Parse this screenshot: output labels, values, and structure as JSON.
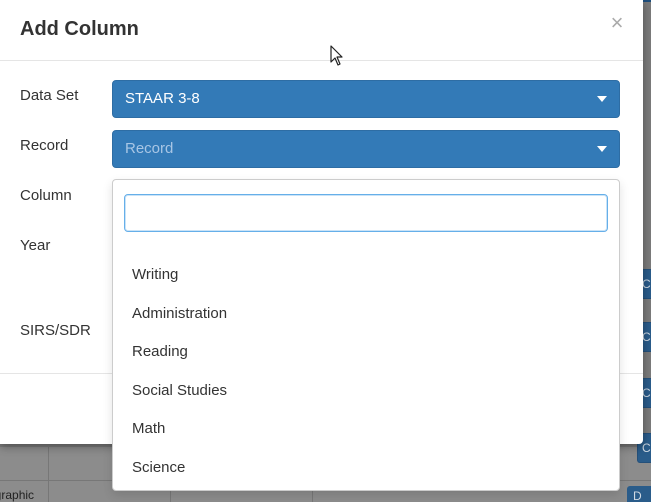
{
  "background": {
    "side_buttons": [
      "Co",
      "Co",
      "Co",
      "Co"
    ],
    "bottom_text": "ographic",
    "bottom_button": "D"
  },
  "modal": {
    "title": "Add Column",
    "close_icon": "close-icon",
    "close_glyph": "×",
    "fields": {
      "data_set": {
        "label": "Data Set",
        "value": "STAAR 3-8"
      },
      "record": {
        "label": "Record",
        "placeholder": "Record"
      },
      "column": {
        "label": "Column"
      },
      "year": {
        "label": "Year"
      },
      "sirs": {
        "label": "SIRS/SDR"
      }
    },
    "dropdown": {
      "search_value": "",
      "options": [
        "Writing",
        "Administration",
        "Reading",
        "Social Studies",
        "Math",
        "Science"
      ]
    }
  },
  "colors": {
    "select_bg": "#337ab7",
    "focus_border": "#66afe9"
  }
}
